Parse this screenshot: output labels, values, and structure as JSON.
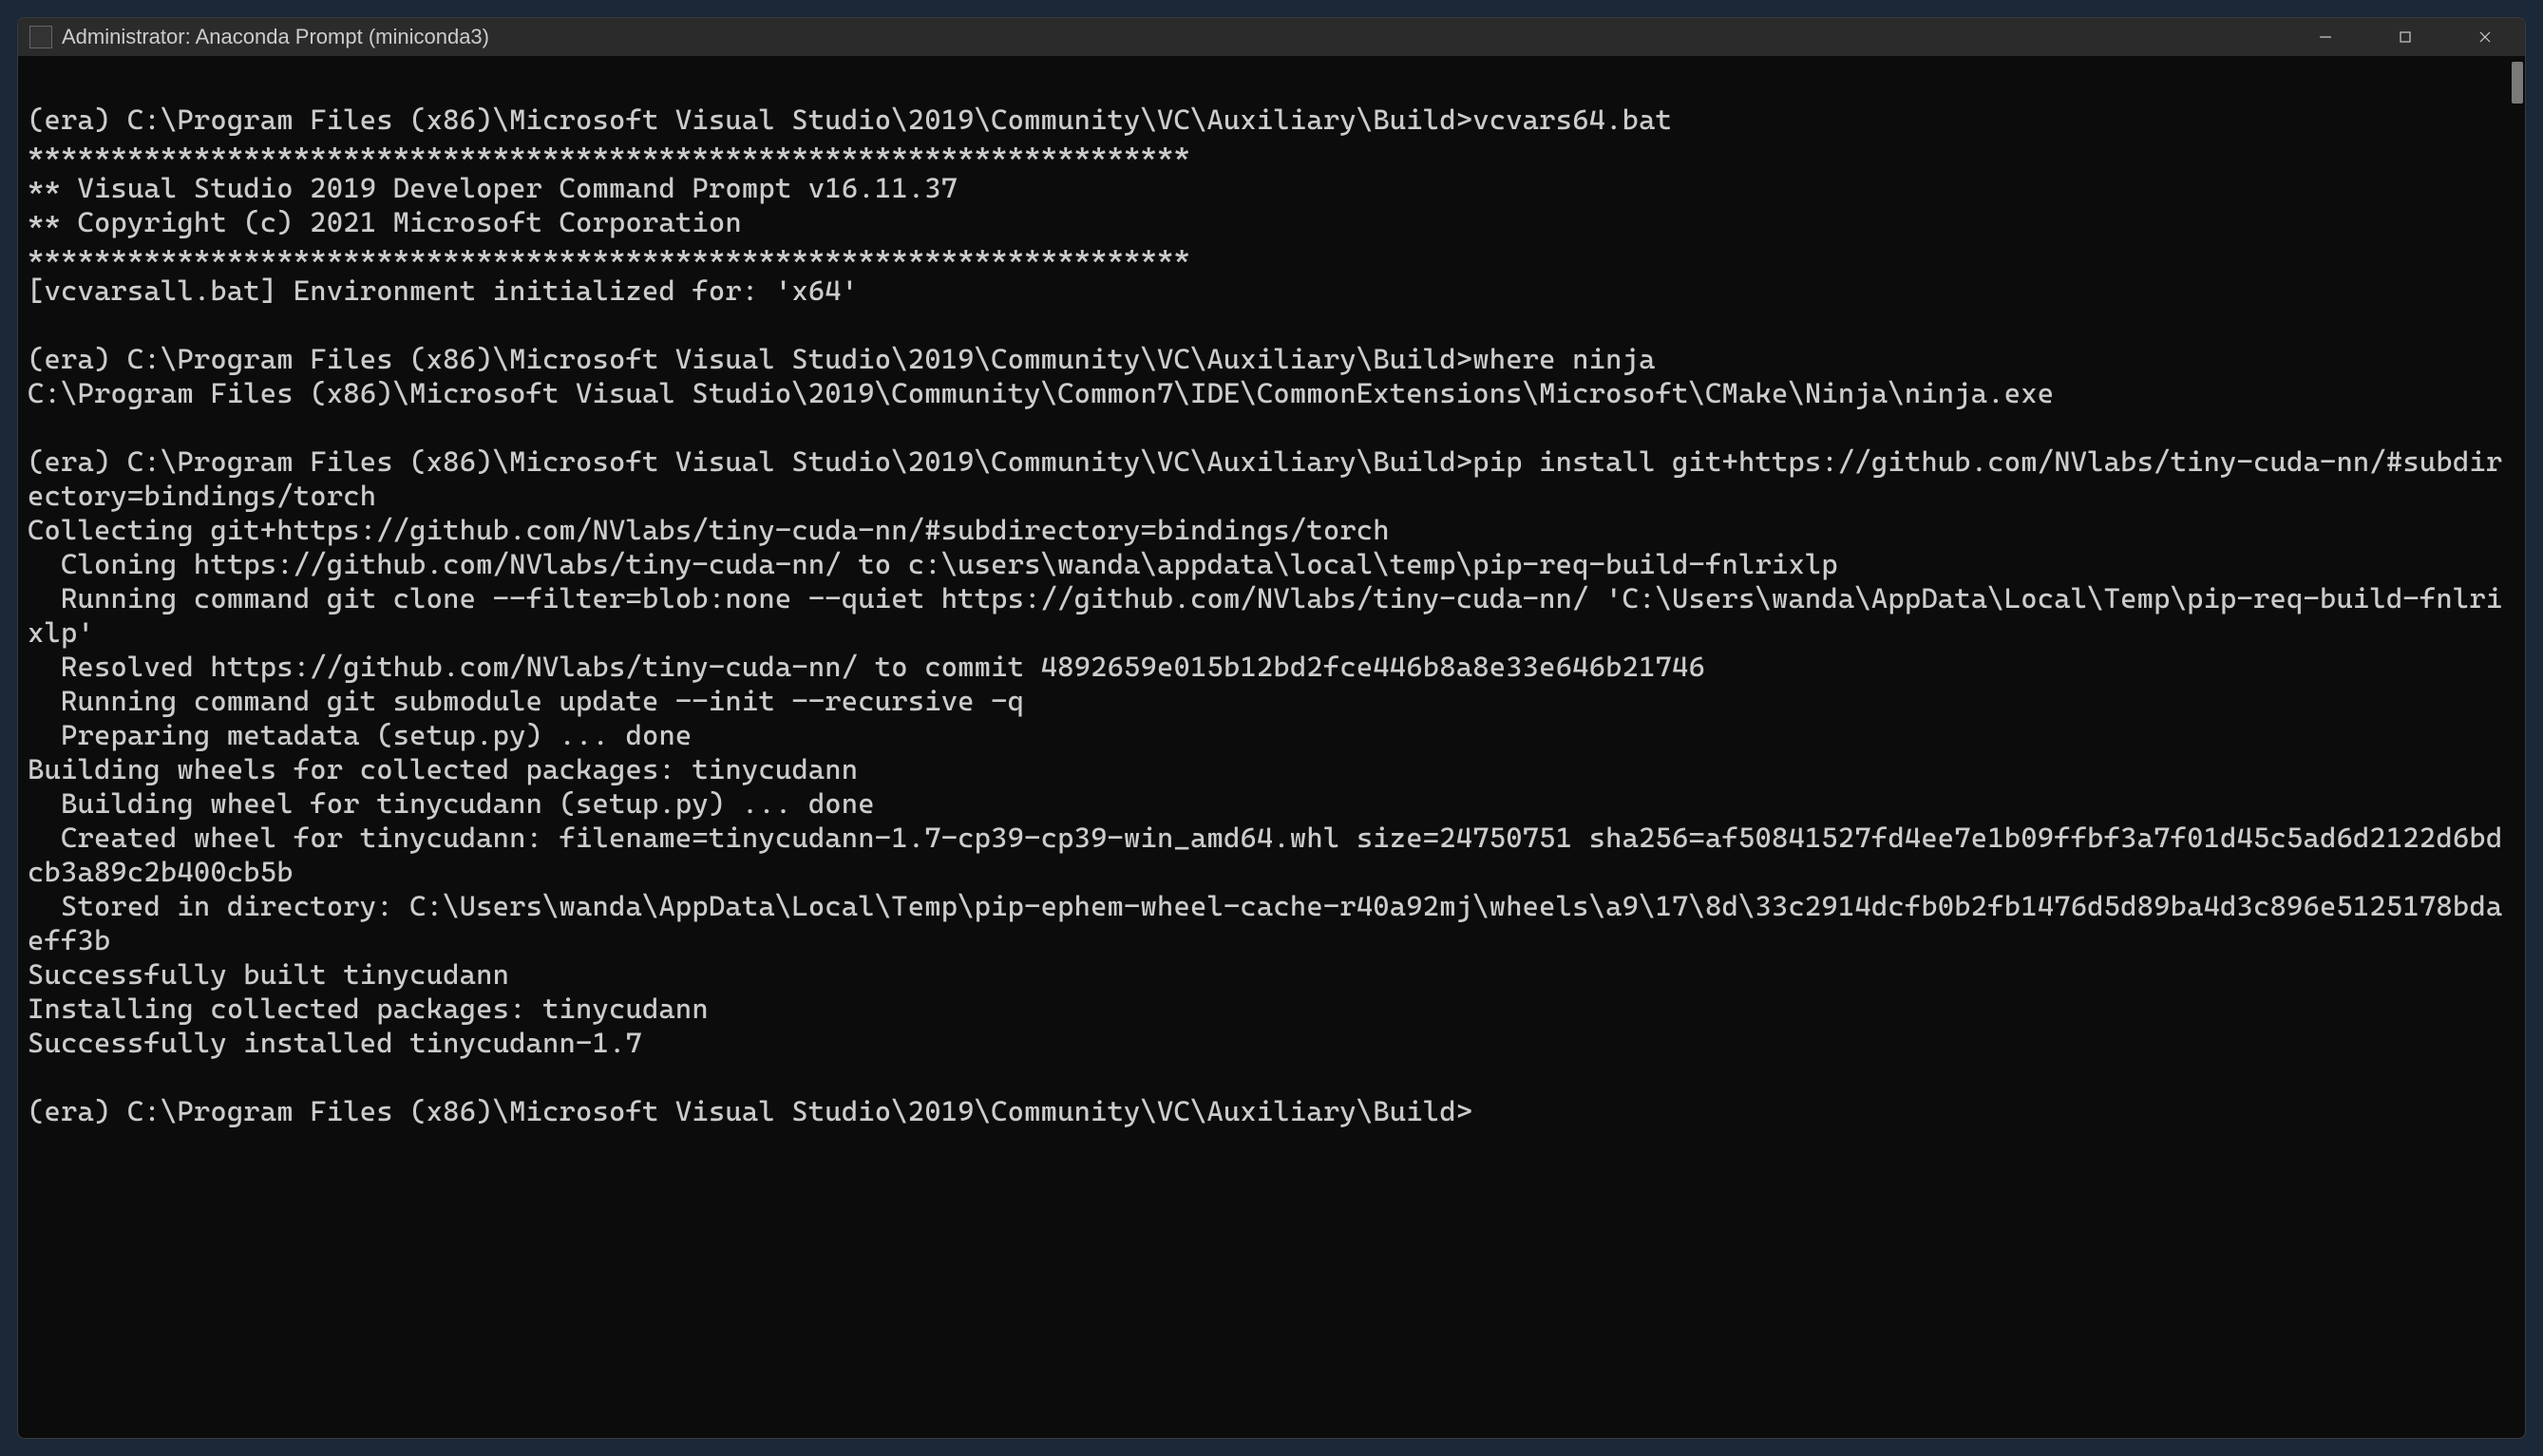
{
  "window": {
    "title": "Administrator: Anaconda Prompt (miniconda3)"
  },
  "term": {
    "prompt_prefix": "(era) C:\\Program Files (x86)\\Microsoft Visual Studio\\2019\\Community\\VC\\Auxiliary\\Build>",
    "cmd1": "vcvars64.bat",
    "stars1": "**********************************************************************",
    "banner1": "** Visual Studio 2019 Developer Command Prompt v16.11.37",
    "banner2": "** Copyright (c) 2021 Microsoft Corporation",
    "stars2": "**********************************************************************",
    "envline": "[vcvarsall.bat] Environment initialized for: 'x64'",
    "cmd2": "where ninja",
    "where_out": "C:\\Program Files (x86)\\Microsoft Visual Studio\\2019\\Community\\Common7\\IDE\\CommonExtensions\\Microsoft\\CMake\\Ninja\\ninja.exe",
    "cmd3": "pip install git+https://github.com/NVlabs/tiny-cuda-nn/#subdirectory=bindings/torch",
    "pip_collect": "Collecting git+https://github.com/NVlabs/tiny-cuda-nn/#subdirectory=bindings/torch",
    "pip_clone": "  Cloning https://github.com/NVlabs/tiny-cuda-nn/ to c:\\users\\wanda\\appdata\\local\\temp\\pip-req-build-fnlrixlp",
    "pip_runclone": "  Running command git clone --filter=blob:none --quiet https://github.com/NVlabs/tiny-cuda-nn/ 'C:\\Users\\wanda\\AppData\\Local\\Temp\\pip-req-build-fnlrixlp'",
    "pip_resolved": "  Resolved https://github.com/NVlabs/tiny-cuda-nn/ to commit 4892659e015b12bd2fce446b8a8e33e646b21746",
    "pip_submod": "  Running command git submodule update --init --recursive -q",
    "pip_meta": "  Preparing metadata (setup.py) ... done",
    "pip_build1": "Building wheels for collected packages: tinycudann",
    "pip_build2": "  Building wheel for tinycudann (setup.py) ... done",
    "pip_wheel": "  Created wheel for tinycudann: filename=tinycudann-1.7-cp39-cp39-win_amd64.whl size=24750751 sha256=af50841527fd4ee7e1b09ffbf3a7f01d45c5ad6d2122d6bdcb3a89c2b400cb5b",
    "pip_stored": "  Stored in directory: C:\\Users\\wanda\\AppData\\Local\\Temp\\pip-ephem-wheel-cache-r40a92mj\\wheels\\a9\\17\\8d\\33c2914dcfb0b2fb1476d5d89ba4d3c896e5125178bdaeff3b",
    "pip_succbuilt": "Successfully built tinycudann",
    "pip_install": "Installing collected packages: tinycudann",
    "pip_succinst": "Successfully installed tinycudann-1.7"
  }
}
